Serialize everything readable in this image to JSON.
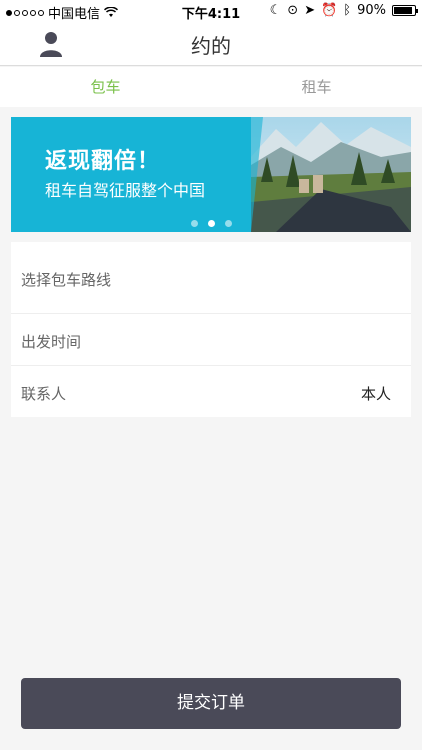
{
  "status_bar": {
    "carrier": "中国电信",
    "time": "下午4:11",
    "battery": "90%",
    "battery_level": 0.9
  },
  "nav": {
    "title": "约的",
    "profile_icon": "person-icon"
  },
  "tabs": [
    {
      "label": "包车",
      "active": true
    },
    {
      "label": "租车",
      "active": false
    }
  ],
  "banner": {
    "headline": "返现翻倍！",
    "subline": "租车自驾征服整个中国",
    "page_count": 3,
    "active_page": 2,
    "accent": "#17b4d6"
  },
  "form": {
    "route_placeholder": "选择包车路线",
    "time_label": "出发时间",
    "contact_label": "联系人",
    "contact_value": "本人"
  },
  "submit_label": "提交订单",
  "colors": {
    "tab_active": "#7ac04a",
    "submit_bg": "#4a4a58"
  }
}
